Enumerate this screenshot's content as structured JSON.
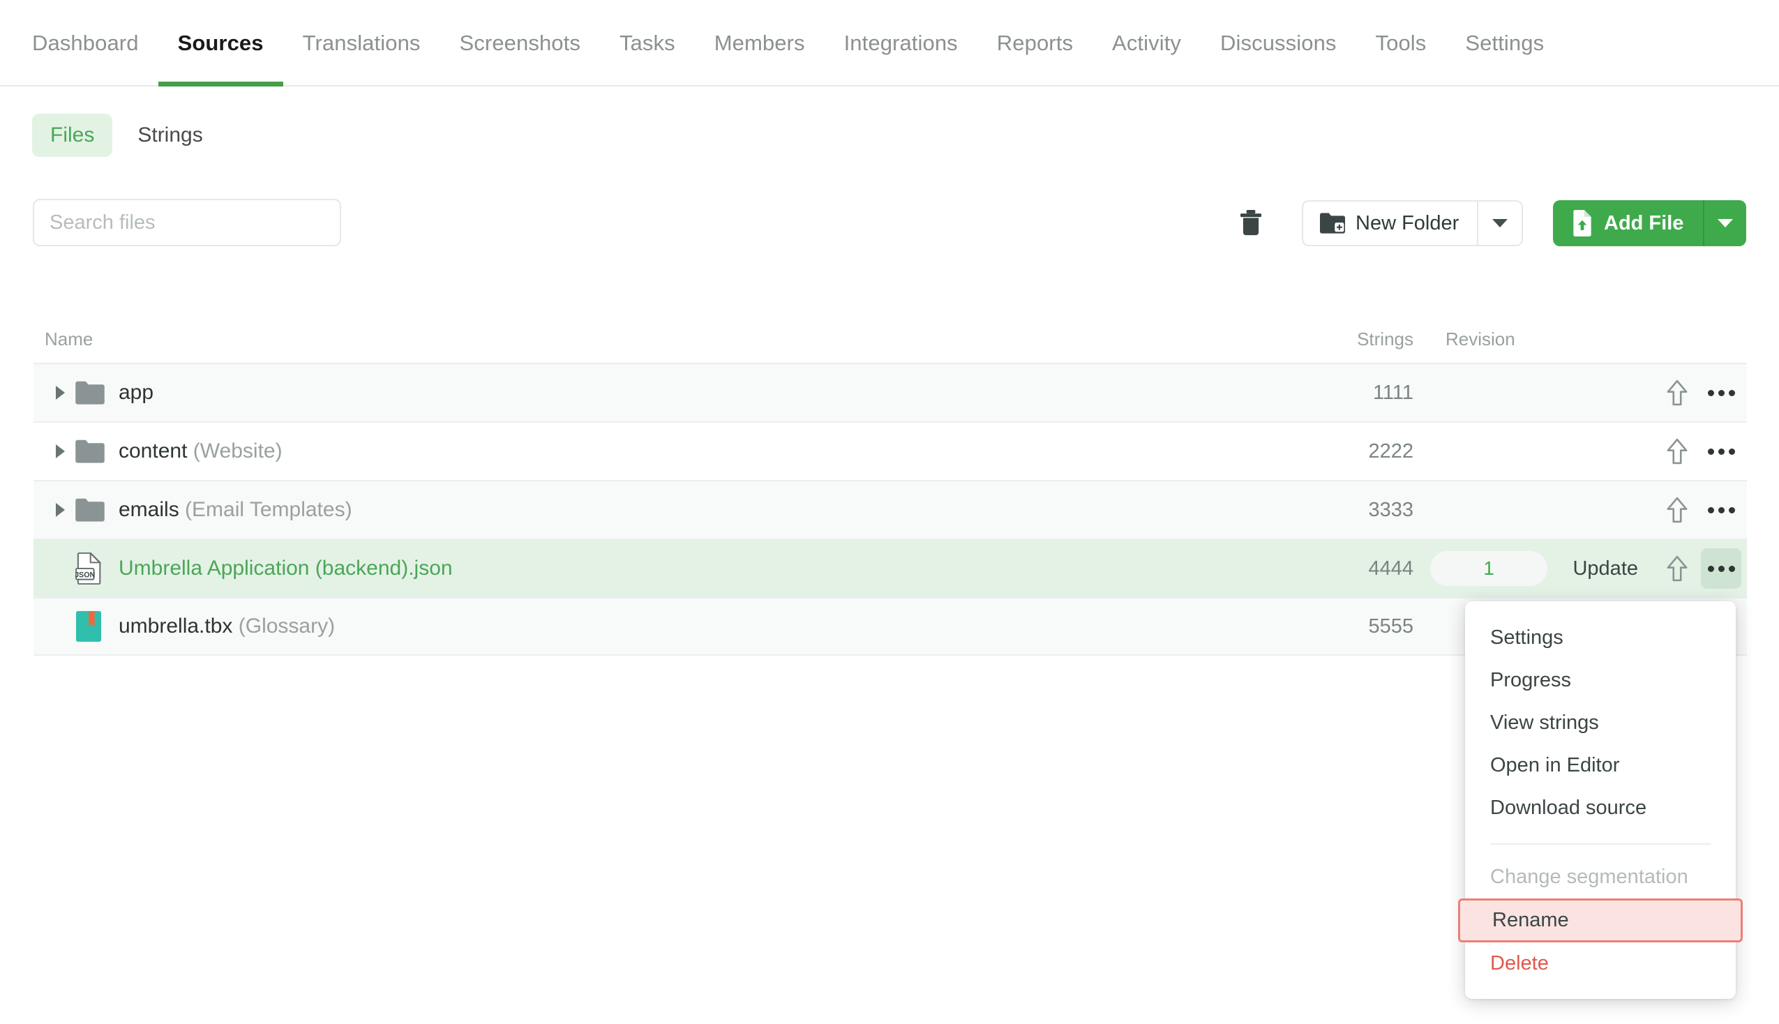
{
  "topnav": {
    "items": [
      {
        "label": "Dashboard",
        "active": false
      },
      {
        "label": "Sources",
        "active": true
      },
      {
        "label": "Translations",
        "active": false
      },
      {
        "label": "Screenshots",
        "active": false
      },
      {
        "label": "Tasks",
        "active": false
      },
      {
        "label": "Members",
        "active": false
      },
      {
        "label": "Integrations",
        "active": false
      },
      {
        "label": "Reports",
        "active": false
      },
      {
        "label": "Activity",
        "active": false
      },
      {
        "label": "Discussions",
        "active": false
      },
      {
        "label": "Tools",
        "active": false
      },
      {
        "label": "Settings",
        "active": false
      }
    ]
  },
  "subtabs": [
    {
      "label": "Files",
      "active": true
    },
    {
      "label": "Strings",
      "active": false
    }
  ],
  "toolbar": {
    "search_placeholder": "Search files",
    "search_value": "",
    "delete_icon": "trash-icon",
    "new_folder_label": "New Folder",
    "add_file_label": "Add File",
    "accent_color": "#3faa4b"
  },
  "table": {
    "columns": {
      "name": "Name",
      "strings": "Strings",
      "revision": "Revision"
    },
    "rows": [
      {
        "name": "app",
        "suffix": "",
        "strings": "1111",
        "revision": "",
        "revision_type": "none",
        "action": "",
        "kind": "folder",
        "expandable": true,
        "selected": false
      },
      {
        "name": "content",
        "suffix": "(Website)",
        "strings": "2222",
        "revision": "",
        "revision_type": "none",
        "action": "",
        "kind": "folder",
        "expandable": true,
        "selected": false
      },
      {
        "name": "emails",
        "suffix": "(Email Templates)",
        "strings": "3333",
        "revision": "",
        "revision_type": "none",
        "action": "",
        "kind": "folder",
        "expandable": true,
        "selected": false
      },
      {
        "name": "Umbrella Application (backend).json",
        "suffix": "",
        "strings": "4444",
        "revision": "1",
        "revision_type": "pill",
        "action": "Update",
        "kind": "json",
        "expandable": false,
        "selected": true
      },
      {
        "name": "umbrella.tbx",
        "suffix": "(Glossary)",
        "strings": "5555",
        "revision": "—",
        "revision_type": "dash",
        "action": "",
        "kind": "glossary",
        "expandable": false,
        "selected": false
      }
    ]
  },
  "dropdown": {
    "items": [
      {
        "label": "Settings",
        "state": "normal"
      },
      {
        "label": "Progress",
        "state": "normal"
      },
      {
        "label": "View strings",
        "state": "normal"
      },
      {
        "label": "Open in Editor",
        "state": "normal"
      },
      {
        "label": "Download source",
        "state": "normal"
      },
      {
        "label": "Change segmentation",
        "state": "disabled"
      },
      {
        "label": "Rename",
        "state": "highlight"
      },
      {
        "label": "Delete",
        "state": "danger"
      }
    ],
    "highlight_border_color": "#ec7f76",
    "highlight_fill_color": "#fbe3e1",
    "danger_color": "#e2574c"
  }
}
